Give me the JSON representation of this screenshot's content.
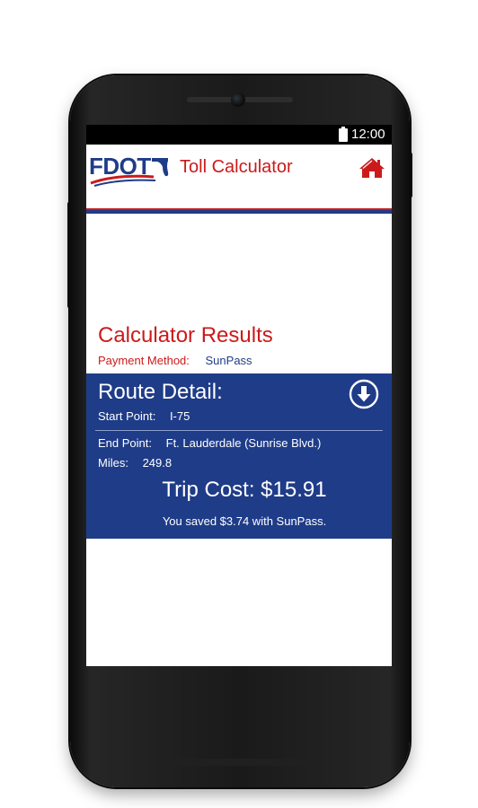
{
  "status_bar": {
    "time": "12:00"
  },
  "header": {
    "logo_text": "FDOT",
    "title": "Toll Calculator"
  },
  "results": {
    "title": "Calculator Results",
    "payment_label": "Payment Method:",
    "payment_value": "SunPass"
  },
  "route": {
    "title": "Route Detail:",
    "start_label": "Start Point:",
    "start_value": "I-75",
    "end_label": "End Point:",
    "end_value": "Ft. Lauderdale (Sunrise Blvd.)",
    "miles_label": "Miles:",
    "miles_value": "249.8",
    "trip_cost": "Trip Cost: $15.91",
    "saved_message": "You saved $3.74 with SunPass."
  },
  "colors": {
    "brand_blue": "#1f3c88",
    "brand_red": "#cc1a1a"
  },
  "icons": [
    "battery-icon",
    "florida-logo-icon",
    "home-icon",
    "download-arrow-icon"
  ]
}
